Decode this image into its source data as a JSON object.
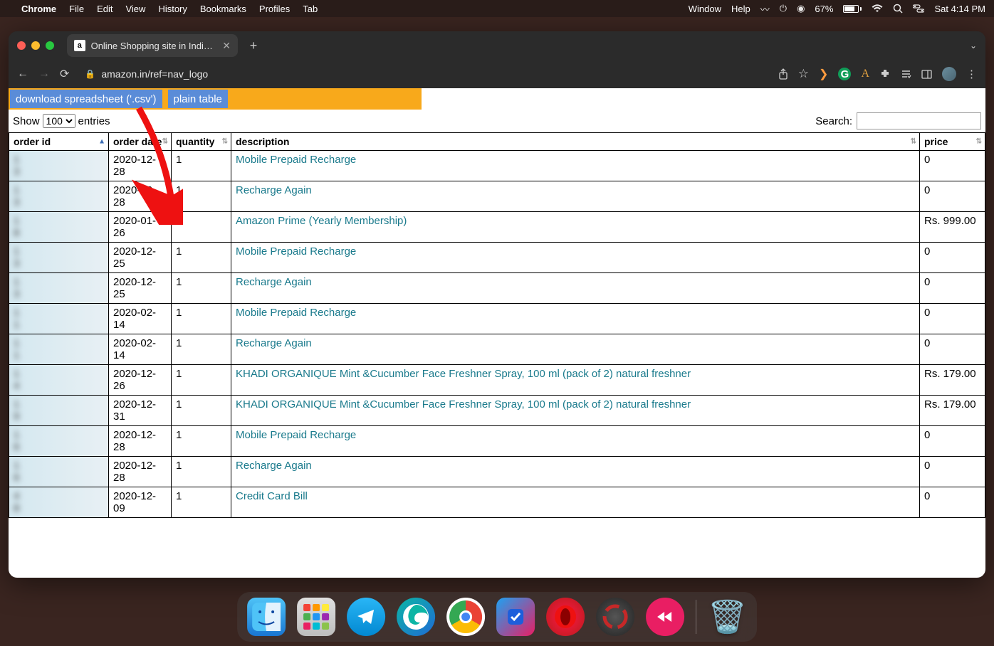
{
  "menubar": {
    "app": "Chrome",
    "items": [
      "File",
      "Edit",
      "View",
      "History",
      "Bookmarks",
      "Profiles",
      "Tab"
    ],
    "right_items": [
      "Window",
      "Help"
    ],
    "battery": "67%",
    "clock": "Sat  4:14 PM"
  },
  "browser": {
    "tab_title": "Online Shopping site in India: S",
    "url": "amazon.in/ref=nav_logo"
  },
  "banner": {
    "download": "download spreadsheet ('.csv')",
    "plain": "plain table"
  },
  "controls": {
    "show": "Show",
    "entries": "entries",
    "count": "100",
    "search_label": "Search:"
  },
  "headers": {
    "order_id": "order id",
    "order_date": "order date",
    "quantity": "quantity",
    "description": "description",
    "price": "price"
  },
  "rows": [
    {
      "id": "1\n3",
      "date": "2020-12-28",
      "qty": "1",
      "desc": "Mobile Prepaid Recharge",
      "price": "0"
    },
    {
      "id": "1\n3",
      "date": "2020-12-28",
      "qty": "1",
      "desc": "Recharge Again",
      "price": "0"
    },
    {
      "id": "1\n8",
      "date": "2020-01-26",
      "qty": "1",
      "desc": "Amazon Prime (Yearly Membership)",
      "price": "Rs. 999.00"
    },
    {
      "id": "1\n3",
      "date": "2020-12-25",
      "qty": "1",
      "desc": "Mobile Prepaid Recharge",
      "price": "0"
    },
    {
      "id": "1\n3",
      "date": "2020-12-25",
      "qty": "1",
      "desc": "Recharge Again",
      "price": "0"
    },
    {
      "id": "1\n1",
      "date": "2020-02-14",
      "qty": "1",
      "desc": "Mobile Prepaid Recharge",
      "price": "0"
    },
    {
      "id": "1\n1",
      "date": "2020-02-14",
      "qty": "1",
      "desc": "Recharge Again",
      "price": "0"
    },
    {
      "id": "1\n4",
      "date": "2020-12-26",
      "qty": "1",
      "desc": "KHADI ORGANIQUE Mint &Cucumber Face Freshner Spray, 100 ml (pack of 2) natural freshner",
      "price": "Rs. 179.00"
    },
    {
      "id": "1\n9",
      "date": "2020-12-31",
      "qty": "1",
      "desc": "KHADI ORGANIQUE Mint &Cucumber Face Freshner Spray, 100 ml (pack of 2) natural freshner",
      "price": "Rs. 179.00"
    },
    {
      "id": "1\n6",
      "date": "2020-12-28",
      "qty": "1",
      "desc": "Mobile Prepaid Recharge",
      "price": "0"
    },
    {
      "id": "1\n6",
      "date": "2020-12-28",
      "qty": "1",
      "desc": "Recharge Again",
      "price": "0"
    },
    {
      "id": "4\n8",
      "date": "2020-12-09",
      "qty": "1",
      "desc": "Credit Card Bill",
      "price": "0"
    }
  ]
}
